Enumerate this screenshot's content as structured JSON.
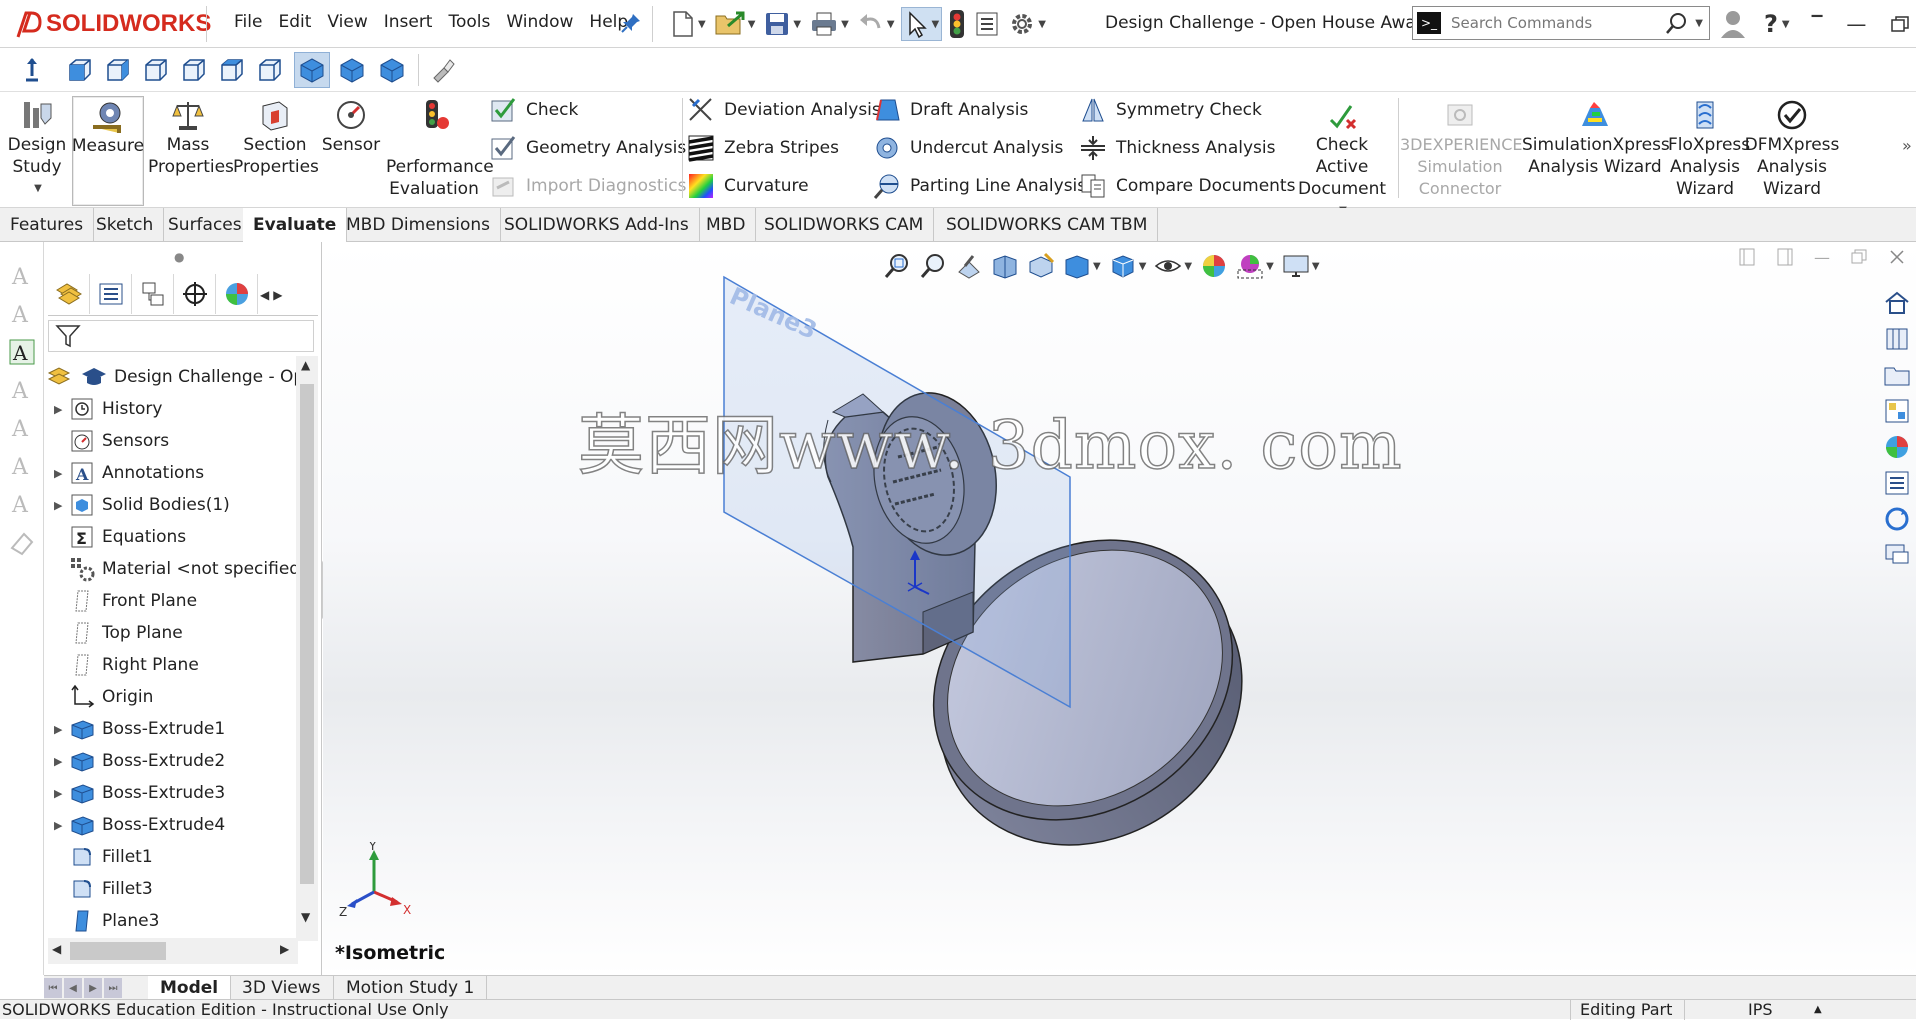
{
  "app": {
    "brand": "SOLIDWORKS"
  },
  "menu": [
    "File",
    "Edit",
    "View",
    "Insert",
    "Tools",
    "Window",
    "Help"
  ],
  "document_title": "Design Challenge - Open House Award",
  "search": {
    "placeholder": "Search Commands"
  },
  "ribbon": {
    "design_study": "Design Study",
    "measure": "Measure",
    "mass_properties": "Mass Properties",
    "section_properties": "Section Properties",
    "sensor": "Sensor",
    "performance_evaluation": "Performance Evaluation",
    "check": "Check",
    "geometry_analysis": "Geometry Analysis",
    "import_diagnostics": "Import Diagnostics",
    "deviation_analysis": "Deviation Analysis",
    "zebra_stripes": "Zebra Stripes",
    "curvature": "Curvature",
    "draft_analysis": "Draft Analysis",
    "undercut_analysis": "Undercut Analysis",
    "parting_line_analysis": "Parting Line Analysis",
    "symmetry_check": "Symmetry Check",
    "thickness_analysis": "Thickness Analysis",
    "compare_documents": "Compare Documents",
    "check_active_document": "Check Active Document",
    "experience_sim": "3DEXPERIENCE Simulation Connector",
    "simxpress": "SimulationXpress Analysis Wizard",
    "floxpress": "FloXpress Analysis Wizard",
    "dfmxpress": "DFMXpress Analysis Wizard"
  },
  "tabs": [
    "Features",
    "Sketch",
    "Surfaces",
    "Evaluate",
    "MBD Dimensions",
    "SOLIDWORKS Add-Ins",
    "MBD",
    "SOLIDWORKS CAM",
    "SOLIDWORKS CAM TBM"
  ],
  "tree": {
    "root": "Design Challenge - Op",
    "items": [
      "History",
      "Sensors",
      "Annotations",
      "Solid Bodies(1)",
      "Equations",
      "Material <not specified>",
      "Front Plane",
      "Top Plane",
      "Right Plane",
      "Origin",
      "Boss-Extrude1",
      "Boss-Extrude2",
      "Boss-Extrude3",
      "Boss-Extrude4",
      "Fillet1",
      "Fillet3",
      "Plane3"
    ]
  },
  "viewport": {
    "view_name": "*Isometric",
    "plane_label": "Plane3",
    "watermark": "莫西网www. 3dmox. com",
    "triad": {
      "x": "X",
      "y": "Y",
      "z": "Z"
    }
  },
  "bottom_tabs": [
    "Model",
    "3D Views",
    "Motion Study 1"
  ],
  "status": {
    "left": "SOLIDWORKS Education Edition - Instructional Use Only",
    "mode": "Editing Part",
    "units": "IPS"
  },
  "colors": {
    "brand_red": "#d52b1e",
    "selection_blue": "#c6d9ee",
    "part_gray": "#8e94a8",
    "plane_blue": "#4a7fd4"
  }
}
